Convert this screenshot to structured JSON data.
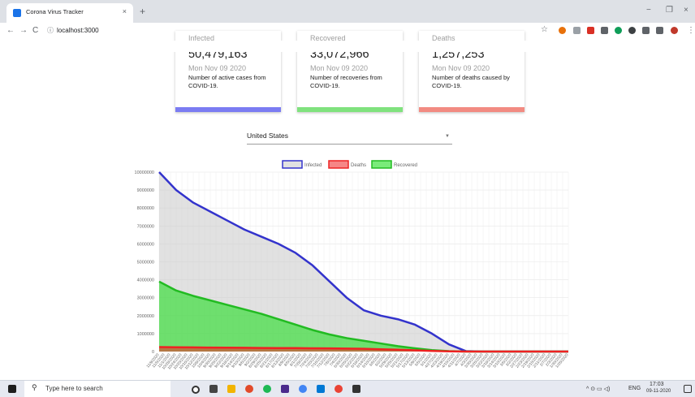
{
  "browser": {
    "tab_title": "Corona Virus Tracker",
    "tab_close": "×",
    "new_tab": "+",
    "url": "localhost:3000",
    "minimize": "−",
    "maximize": "❐",
    "close": "×"
  },
  "cards": [
    {
      "label": "Infected",
      "number": "50,479,163",
      "date": "Mon Nov 09 2020",
      "desc": "Number of active cases from COVID-19.",
      "color": "#7b7cf2"
    },
    {
      "label": "Recovered",
      "number": "33,072,966",
      "date": "Mon Nov 09 2020",
      "desc": "Number of recoveries from COVID-19.",
      "color": "#80e27e"
    },
    {
      "label": "Deaths",
      "number": "1,257,253",
      "date": "Mon Nov 09 2020",
      "desc": "Number of deaths caused by COVID-19.",
      "color": "#f28b82"
    }
  ],
  "country_select": {
    "value": "United States"
  },
  "chart_data": {
    "type": "line",
    "series": [
      {
        "name": "Infected",
        "color": "#3333cc",
        "fill": "rgba(200,200,200,0.55)",
        "values": [
          10000000,
          9000000,
          8300000,
          7800000,
          7300000,
          6800000,
          6400000,
          6000000,
          5500000,
          4800000,
          3900000,
          3000000,
          2300000,
          2000000,
          1800000,
          1500000,
          1000000,
          400000,
          20000,
          0,
          0,
          0,
          0,
          0,
          0
        ]
      },
      {
        "name": "Deaths",
        "color": "#ee2222",
        "fill": "rgba(238,34,34,0.55)",
        "values": [
          250000,
          240000,
          230000,
          220000,
          215000,
          210000,
          200000,
          195000,
          190000,
          180000,
          175000,
          165000,
          150000,
          125000,
          100000,
          70000,
          35000,
          10000,
          0,
          0,
          0,
          0,
          0,
          0,
          0
        ]
      },
      {
        "name": "Recovered",
        "color": "#22bb22",
        "fill": "rgba(34,221,34,0.6)",
        "values": [
          3900000,
          3400000,
          3100000,
          2850000,
          2600000,
          2350000,
          2100000,
          1800000,
          1500000,
          1200000,
          950000,
          750000,
          600000,
          450000,
          300000,
          180000,
          80000,
          20000,
          0,
          0,
          0,
          0,
          0,
          0,
          0
        ]
      }
    ],
    "x_labels": [
      "11/9/2020",
      "11/5/2020",
      "11/1/2020",
      "10/28/2020",
      "10/24/2020",
      "10/20/2020",
      "10/16/2020",
      "10/12/2020",
      "10/8/2020",
      "10/4/2020",
      "9/30/2020",
      "9/26/2020",
      "9/22/2020",
      "9/18/2020",
      "9/14/2020",
      "9/10/2020",
      "9/6/2020",
      "9/2/2020",
      "8/29/2020",
      "8/25/2020",
      "8/21/2020",
      "8/17/2020",
      "8/13/2020",
      "8/9/2020",
      "8/5/2020",
      "8/1/2020",
      "7/28/2020",
      "7/24/2020",
      "7/20/2020",
      "7/16/2020",
      "7/12/2020",
      "7/8/2020",
      "7/4/2020",
      "6/30/2020",
      "6/26/2020",
      "6/22/2020",
      "6/18/2020",
      "6/14/2020",
      "6/10/2020",
      "6/6/2020",
      "6/2/2020",
      "5/29/2020",
      "5/25/2020",
      "5/21/2020",
      "5/17/2020",
      "5/13/2020",
      "5/9/2020",
      "5/5/2020",
      "5/1/2020",
      "4/27/2020",
      "4/23/2020",
      "4/19/2020",
      "4/15/2020",
      "4/11/2020",
      "4/7/2020",
      "4/3/2020",
      "3/30/2020",
      "3/26/2020",
      "3/22/2020",
      "3/18/2020",
      "3/14/2020",
      "3/10/2020",
      "3/6/2020",
      "3/2/2020",
      "2/27/2020",
      "2/23/2020",
      "2/19/2020",
      "2/15/2020",
      "2/11/2020",
      "2/7/2020",
      "2/3/2020",
      "1/30/2020",
      "1/26/2020"
    ],
    "y_ticks": [
      "10000000",
      "9000000",
      "8000000",
      "7000000",
      "6000000",
      "5000000",
      "4000000",
      "3000000",
      "2000000",
      "1000000",
      "0"
    ],
    "ylim": [
      0,
      10000000
    ],
    "grid": true,
    "legend": "top-center"
  },
  "taskbar": {
    "search_placeholder": "Type here to search",
    "lang": "ENG",
    "time": "17:03",
    "date": "09-11-2020"
  }
}
